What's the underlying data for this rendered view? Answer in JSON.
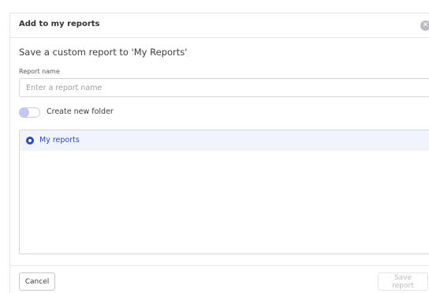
{
  "modal": {
    "title": "Add to my reports",
    "close_icon": "close-icon",
    "subtitle": "Save a custom report to 'My Reports'"
  },
  "report_name": {
    "label": "Report name",
    "value": "",
    "placeholder": "Enter a report name"
  },
  "new_folder_toggle": {
    "label": "Create new folder",
    "on": false
  },
  "folders": {
    "items": [
      {
        "label": "My reports",
        "selected": true
      }
    ]
  },
  "footer": {
    "cancel_label": "Cancel",
    "save_label": "Save report",
    "save_enabled": false
  },
  "colors": {
    "accent": "#2b48c7",
    "selected_row_bg": "#f2f4fc",
    "disabled_text": "#b7bbc0"
  }
}
